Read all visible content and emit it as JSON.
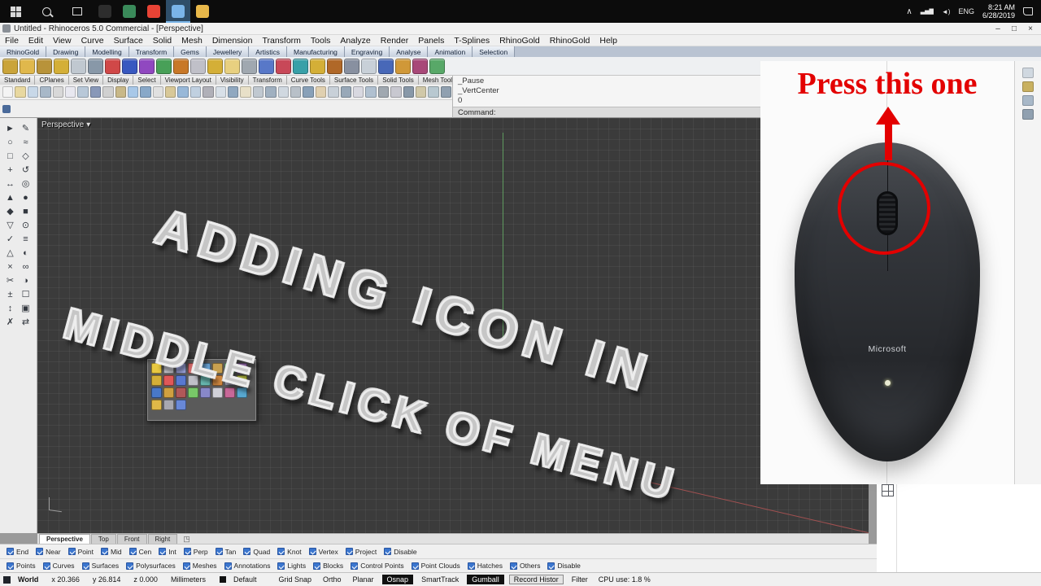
{
  "taskbar": {
    "apps": [
      {
        "bg": "#2d2d2d"
      },
      {
        "bg": "#3a8a5a"
      },
      {
        "bg": "#e84335"
      },
      {
        "bg": "#7ab4e8",
        "active": true
      },
      {
        "bg": "#e8b84a"
      }
    ],
    "tray": {
      "chevron": "∧",
      "network": "▃▅▇",
      "speaker": "◄)",
      "lang": "ENG",
      "time": "8:21 AM",
      "date": "6/28/2019",
      "note": "▭"
    }
  },
  "titlebar": {
    "title": "Untitled - Rhinoceros 5.0 Commercial - [Perspective]",
    "min": "–",
    "max": "□",
    "close": "×"
  },
  "menubar": {
    "items": [
      "File",
      "Edit",
      "View",
      "Curve",
      "Surface",
      "Solid",
      "Mesh",
      "Dimension",
      "Transform",
      "Tools",
      "Analyze",
      "Render",
      "Panels",
      "T-Splines",
      "RhinoGold",
      "RhinoGold",
      "Help"
    ]
  },
  "rhinogold_tabs": [
    "RhinoGold",
    "Drawing",
    "Modelling",
    "Transform",
    "Gems",
    "Jewellery",
    "Artistics",
    "Manufacturing",
    "Engraving",
    "Analyse",
    "Animation",
    "Selection"
  ],
  "toolbar_tabs": [
    "Standard",
    "CPlanes",
    "Set View",
    "Display",
    "Select",
    "Viewport Layout",
    "Visibility",
    "Transform",
    "Curve Tools",
    "Surface Tools",
    "Solid Tools",
    "Mesh Tools",
    "»"
  ],
  "command": {
    "history": "_Pause\n_VertCenter\n0",
    "prompt": "Command:"
  },
  "viewport": {
    "label": "Perspective",
    "caret": "▾",
    "line1": "ADDING ICON IN",
    "line2": "MIDDLE CLICK OF MENU",
    "tab_extra": "◳"
  },
  "viewport_tabs": [
    {
      "label": "Perspective",
      "active": true
    },
    {
      "label": "Top"
    },
    {
      "label": "Front"
    },
    {
      "label": "Right"
    }
  ],
  "osnap_row": [
    "End",
    "Near",
    "Point",
    "Mid",
    "Cen",
    "Int",
    "Perp",
    "Tan",
    "Quad",
    "Knot",
    "Vertex",
    "Project",
    "Disable"
  ],
  "filter_row": [
    "Points",
    "Curves",
    "Surfaces",
    "Polysurfaces",
    "Meshes",
    "Annotations",
    "Lights",
    "Blocks",
    "Control Points",
    "Point Clouds",
    "Hatches",
    "Others",
    "Disable"
  ],
  "status": {
    "world": "World",
    "x": "x 20.366",
    "y": "y 26.814",
    "z": "z 0.000",
    "units": "Millimeters",
    "layer": "Default",
    "buttons": [
      {
        "label": "Grid Snap"
      },
      {
        "label": "Ortho"
      },
      {
        "label": "Planar"
      },
      {
        "label": "Osnap",
        "style": "dark"
      },
      {
        "label": "SmartTrack"
      },
      {
        "label": "Gumball",
        "style": "dark"
      },
      {
        "label": "Record Histor",
        "style": "boxed"
      },
      {
        "label": "Filter"
      }
    ],
    "cpu": "CPU use: 1.8 %"
  },
  "overlay": {
    "caption": "Press this one",
    "brand": "Microsoft"
  },
  "icons": {
    "rhinogold_row": [
      "#caa43a",
      "#e0b84c",
      "#b8933a",
      "#d4af37",
      "#c0c8d0",
      "#8898a8",
      "#d04848",
      "#3858c0",
      "#9048c0",
      "#48a058",
      "#c87828",
      "#c0c0c8",
      "#d4af37",
      "#e8d080",
      "#a0a8b0",
      "#5878c8",
      "#c84858",
      "#38a0a8",
      "#d4af37",
      "#b06828",
      "#8890a0",
      "#c8d0d8",
      "#4868b8",
      "#d09838",
      "#a84878",
      "#58a868"
    ],
    "standard_row": [
      "#f4f4f4",
      "#e8d8a0",
      "#c8d8e8",
      "#a8b8c8",
      "#d8d8d8",
      "#e8e8f0",
      "#b8c8d8",
      "#8898b8",
      "#d0d0d0",
      "#c8b888",
      "#a8c8e8",
      "#88a8c8",
      "#e0e0e0",
      "#d8c898",
      "#98b8d8",
      "#c0d0e0",
      "#b0b0b8",
      "#d8e0e8",
      "#90a8c0",
      "#e8e0c8",
      "#c0c8d0",
      "#a0b0c0",
      "#d0d8e0",
      "#b8c0c8",
      "#88a0b8",
      "#e0d0b0",
      "#c8d0d8",
      "#98a8b8",
      "#d8d8e0",
      "#b0c0d0",
      "#a0a8b0",
      "#c8c8d0",
      "#8898a8",
      "#d0c8a8",
      "#b8c8d0",
      "#90a0b0"
    ],
    "sidebar": [
      {
        "g": "►"
      },
      {
        "g": "✎"
      },
      {
        "g": "○"
      },
      {
        "g": "≈"
      },
      {
        "g": "□"
      },
      {
        "g": "◇"
      },
      {
        "g": "+"
      },
      {
        "g": "↺"
      },
      {
        "g": "↔"
      },
      {
        "g": "◎"
      },
      {
        "g": "▲"
      },
      {
        "g": "●"
      },
      {
        "g": "◆"
      },
      {
        "g": "■"
      },
      {
        "g": "▽"
      },
      {
        "g": "⊙"
      },
      {
        "g": "✓"
      },
      {
        "g": "≡"
      },
      {
        "g": "△"
      },
      {
        "g": "◐"
      },
      {
        "g": "×"
      },
      {
        "g": "∞"
      },
      {
        "g": "✂"
      },
      {
        "g": "◑"
      },
      {
        "g": "±"
      },
      {
        "g": "☐"
      },
      {
        "g": "↕"
      },
      {
        "g": "▣"
      },
      {
        "g": "✗"
      },
      {
        "g": "⇄"
      }
    ],
    "popup": [
      "#e8c840",
      "#c8c8d0",
      "#a0a8e0",
      "#d06868",
      "#68a0d0",
      "#c8a050",
      "#88c890",
      "#b080c8",
      "#d4af37",
      "#e05858",
      "#5878d0",
      "#c0c0c8",
      "#68b8b0",
      "#d08840",
      "#9898a8",
      "#c8d048",
      "#4878c8",
      "#d0a040",
      "#b05858",
      "#78c868",
      "#8888c8",
      "#d0d0d8",
      "#c86898",
      "#58a8d0",
      "#e0b848",
      "#a8a8b0",
      "#6888d8"
    ],
    "rightstrip": [
      "#d0d8e0",
      "#c8b060",
      "#a8b8c8",
      "#90a0b0"
    ]
  }
}
